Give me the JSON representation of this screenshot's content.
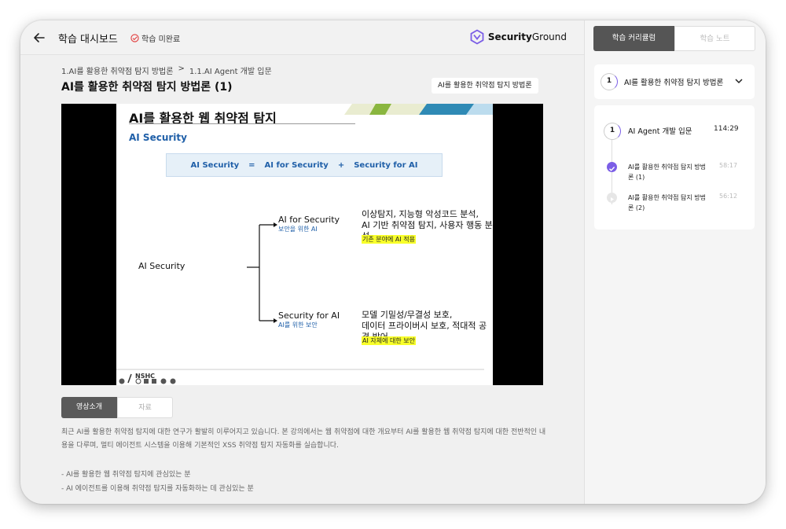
{
  "header": {
    "page_heading": "학습 대시보드",
    "status": "학습 미완료",
    "brand_bold": "Security",
    "brand_light": "Ground"
  },
  "breadcrumb": {
    "level1": "1.AI를 활용한 취약점 탐지 방법론",
    "separator": ">",
    "level2": "1.1.AI Agent 개발 입문"
  },
  "lecture": {
    "title": "AI를 활용한 취약점 탐지 방법론 (1)",
    "tag": "AI를 활용한 취약점 탐지 방법론"
  },
  "slide": {
    "title": "AI를 활용한 웹 취약점 탐지",
    "subtitle": "AI Security",
    "equation": {
      "a": "AI Security",
      "eq": "=",
      "b": "AI for Security",
      "plus": "+",
      "c": "Security for AI"
    },
    "root": "AI Security",
    "branch1": {
      "name": "AI for Security",
      "sub": "보안을 위한 AI",
      "desc1": "이상탐지, 지능형 악성코드 분석,",
      "desc2": "AI 기반 취약점 탐지, 사용자 행동 분석",
      "highlight": "기존 분야에 AI 적용"
    },
    "branch2": {
      "name": "Security for AI",
      "sub": "AI를 위한 보안",
      "desc1": "모델 기밀성/무결성 보호,",
      "desc2": "데이터 프라이버시 보호, 적대적 공격 방어",
      "highlight": "AI 자체에 대한 보안"
    },
    "footer_logo": "NSHC"
  },
  "content_tabs": {
    "intro": "영상소개",
    "materials": "자료"
  },
  "intro": {
    "paragraph": "최근 AI를 활용한 취약점 탐지에 대한 연구가 활발히 이루어지고 있습니다. 본 강의에서는 웹 취약점에 대한 개요부터 AI를 활용한 웹 취약점 탐지에 대한 전반적인 내용을 다루며, 멀티 에이전트 시스템을 이용해 기본적인 XSS 취약점 탐지 자동화를 실습합니다.",
    "bullets": [
      "- AI를 활용한 웹 취약점 탐지에 관심있는 분",
      "- AI 에이전트를 이용해 취약점 탐지를 자동화하는 데 관심있는 분"
    ]
  },
  "sidebar": {
    "tabs": {
      "curriculum": "학습 커리큘럼",
      "notes": "학습 노트"
    },
    "chapter": {
      "number": "1",
      "title": "AI를 활용한 취약점 탐지 방법론"
    },
    "section": {
      "number": "1",
      "title": "AI Agent 개발 입문",
      "duration": "114:29"
    },
    "lessons": [
      {
        "title": "AI를 활용한 취약점 탐지 방법론 (1)",
        "duration": "58:17",
        "done": true
      },
      {
        "title": "AI를 활용한 취약점 탐지 방법론 (2)",
        "duration": "56:12",
        "done": false
      }
    ]
  },
  "colors": {
    "accent": "#7b5ee6",
    "slide_blue": "#1f5fa8",
    "highlight": "#f8ff2a"
  }
}
